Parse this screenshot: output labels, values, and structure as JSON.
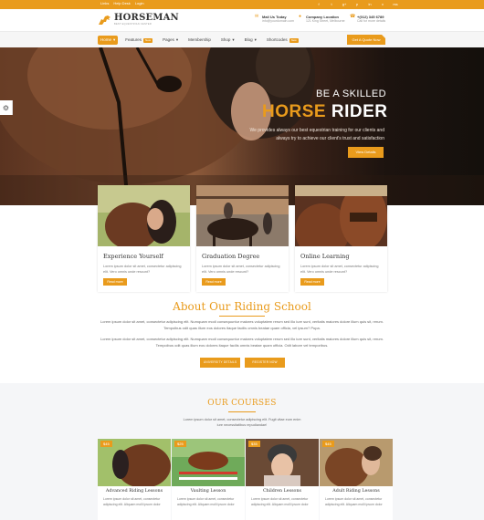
{
  "topbar": {
    "links": [
      "Links",
      "Help Desk",
      "Login"
    ],
    "social": [
      "f",
      "t",
      "g+",
      "p",
      "in",
      "v",
      "rss"
    ]
  },
  "header": {
    "logo_name": "HORSEMAN",
    "logo_tag": "BEST EQUESTRIAN CENTER",
    "contacts": [
      {
        "icon": "mail-icon",
        "title": "Mail Us Today",
        "sub": "info@yourdomain.com"
      },
      {
        "icon": "location-icon",
        "title": "Company Location",
        "sub": "121 King Street, Melbourne"
      },
      {
        "icon": "phone-icon",
        "title": "+(012) 345 6789",
        "sub": "Call for more details"
      }
    ]
  },
  "nav": {
    "items": [
      {
        "label": "Home",
        "badge": ""
      },
      {
        "label": "Features",
        "badge": "New"
      },
      {
        "label": "Pages",
        "badge": ""
      },
      {
        "label": "Membership",
        "badge": ""
      },
      {
        "label": "Shop",
        "badge": ""
      },
      {
        "label": "Blog",
        "badge": ""
      },
      {
        "label": "Shortcodes",
        "badge": "New"
      }
    ],
    "quote_button": "Get A Quote Now"
  },
  "hero": {
    "subtitle": "BE A SKILLED",
    "title_a": "HORSE",
    "title_b": "RIDER",
    "description": "We provides always our best equestrian training for our clients and always try to achieve our client's trust and satisfaction",
    "button": "View Details"
  },
  "features": [
    {
      "title": "Experience Yourself",
      "text": "Lorem ipsum dolor sit amet, consectetur adipiscing elit. Vero omnis unde rescunt?",
      "button": "Read more"
    },
    {
      "title": "Graduation Degree",
      "text": "Lorem ipsum dolor sit amet, consectetur adipiscing elit. Vero omnis unde rescunt?",
      "button": "Read more"
    },
    {
      "title": "Online Learning",
      "text": "Lorem ipsum dolor sit amet, consectetur adipiscing elit. Vero omnis unde rescunt?",
      "button": "Read more"
    }
  ],
  "about": {
    "title": "About Our Riding School",
    "paragraph1": "Lorem ipsum dolor sit amet, consectetur adipiscing elit. Numquam modi consequuntur maiores voluptatem rerum sed illo iure sunt, veritatis maiores dolore illum quis sit, rerum. Tempoibus odit quas illum eos dolores itaque facilis omnis beatae quam officia, vel ipsum? Pupa.",
    "paragraph2": "Lorem ipsum dolor sit amet, consectetur adipiscing elit. Numquam modi consequuntur maiores voluptatem rerum sed illo iure sunt, veritatis maiores dolore illum quis sit, rerum. Tempoibus odit quas illum eos dolores itaque facilis omnis beatae quam officia. Odit labore vel temporibus.",
    "button1": "UNIVERSITY DETAILS",
    "button2": "REGISTER NOW"
  },
  "courses": {
    "title": "OUR COURSES",
    "description": "Lorem ipsum dolor sit amet, consectetur adipiscing elit. Fugit vitae eum enim iure necessitatibus repudiandae!",
    "items": [
      {
        "price": "$45",
        "title": "Advanced Riding Lessons",
        "text": "Lorem ipsum dolor sit amet, consectetur adipiscing elit. Aliquam molli ipsum dolor"
      },
      {
        "price": "$25",
        "title": "Vaulting Lesson",
        "text": "Lorem ipsum dolor sit amet, consectetur adipiscing elit. Aliquam molli ipsum dolor"
      },
      {
        "price": "$35",
        "title": "Children Lessons",
        "text": "Lorem ipsum dolor sit amet, consectetur adipiscing elit. Aliquam molli ipsum dolor"
      },
      {
        "price": "$45",
        "title": "Adult Riding Lessons",
        "text": "Lorem ipsum dolor sit amet, consectetur adipiscing elit. Aliquam molli ipsum dolor"
      }
    ]
  },
  "colors": {
    "accent": "#e99b1c",
    "dark": "#333333",
    "light_bg": "#f5f6f8"
  }
}
